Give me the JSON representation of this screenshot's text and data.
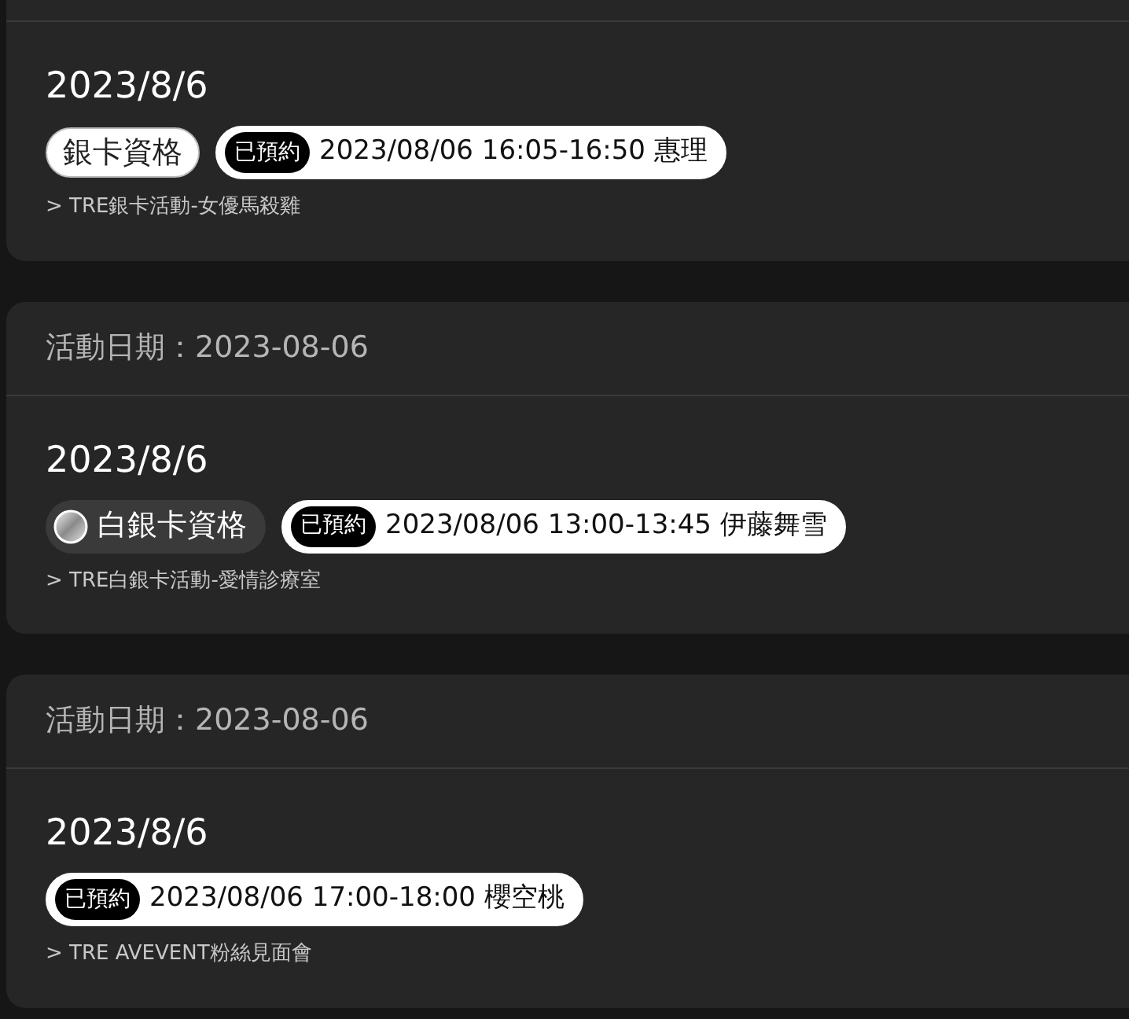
{
  "events": [
    {
      "date": "2023/8/6",
      "badges": [
        {
          "kind": "silver",
          "label": "銀卡資格"
        }
      ],
      "reservation": {
        "status": "已預約",
        "detail": "2023/08/06 16:05-16:50 惠理"
      },
      "link": "> TRE銀卡活動-女優馬殺雞"
    },
    {
      "header": "活動日期：2023-08-06",
      "date": "2023/8/6",
      "badges": [
        {
          "kind": "platinum",
          "label": "白銀卡資格"
        }
      ],
      "reservation": {
        "status": "已預約",
        "detail": "2023/08/06 13:00-13:45 伊藤舞雪"
      },
      "link": "> TRE白銀卡活動-愛情診療室"
    },
    {
      "header": "活動日期：2023-08-06",
      "date": "2023/8/6",
      "reservation": {
        "status": "已預約",
        "detail": "2023/08/06 17:00-18:00 櫻空桃"
      },
      "link": "> TRE AVEVENT粉絲見面會"
    }
  ]
}
